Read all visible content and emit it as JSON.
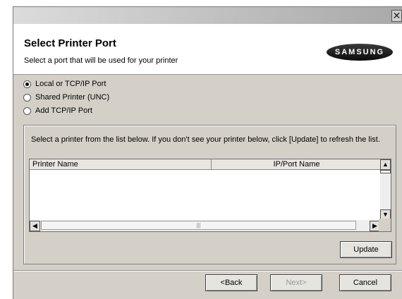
{
  "window": {
    "title": "",
    "close_glyph": "✕"
  },
  "header": {
    "title": "Select Printer Port",
    "subtitle": "Select a port that will be used for your printer",
    "logo_text": "SAMSUNG"
  },
  "port_options": [
    {
      "label": "Local or TCP/IP Port",
      "selected": true
    },
    {
      "label": "Shared Printer (UNC)",
      "selected": false
    },
    {
      "label": "Add TCP/IP Port",
      "selected": false
    }
  ],
  "printer_list": {
    "instruction": "Select a printer from the list below. If you don't see your printer below, click [Update] to refresh the list.",
    "columns": [
      "Printer Name",
      "IP/Port Name"
    ],
    "rows": [],
    "scroll_up_glyph": "▲",
    "scroll_down_glyph": "▼",
    "scroll_left_glyph": "◀",
    "scroll_right_glyph": "▶",
    "thumb_grip": "|||"
  },
  "buttons": {
    "update": "Update",
    "back": "<Back",
    "next": "Next>",
    "cancel": "Cancel"
  }
}
